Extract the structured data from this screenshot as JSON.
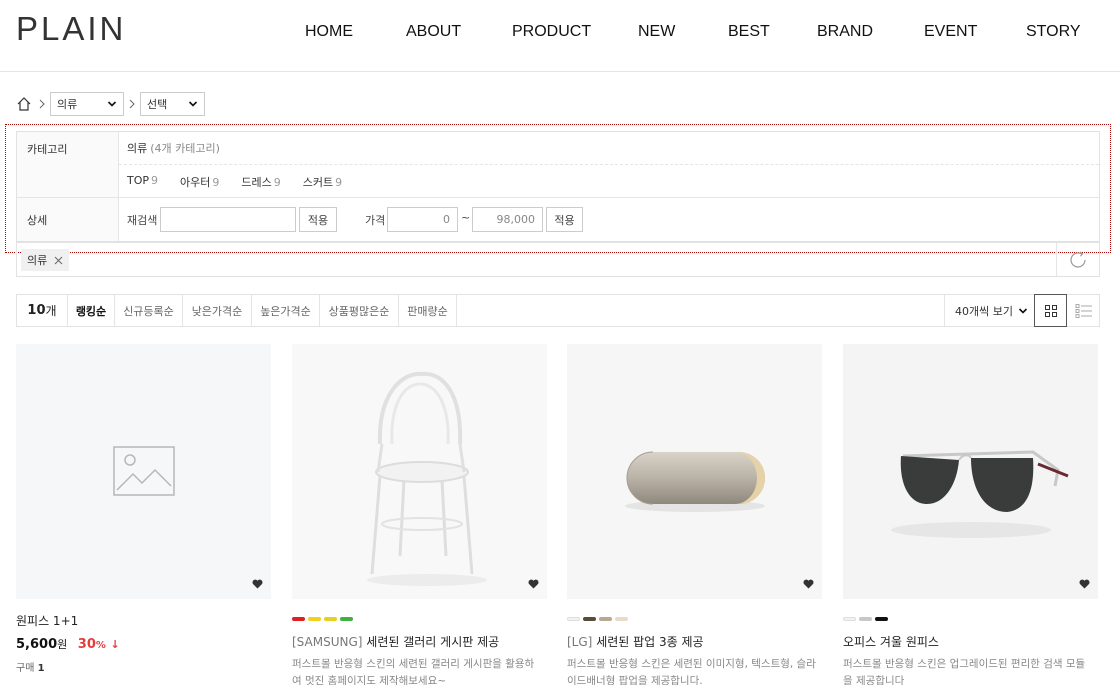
{
  "header": {
    "logo": "PLAIN",
    "nav": [
      "HOME",
      "ABOUT",
      "PRODUCT",
      "NEW",
      "BEST",
      "BRAND",
      "EVENT",
      "STORY"
    ]
  },
  "breadcrumb": {
    "select1": "의류",
    "select2": "선택"
  },
  "filter": {
    "category_label": "카테고리",
    "category_name": "의류",
    "category_sub": "(4개 카테고리)",
    "subcategories": [
      {
        "name": "TOP",
        "count": "9"
      },
      {
        "name": "아우터",
        "count": "9"
      },
      {
        "name": "드레스",
        "count": "9"
      },
      {
        "name": "스커트",
        "count": "9"
      }
    ],
    "detail_label": "상세",
    "research_label": "재검색",
    "apply_label": "적용",
    "price_label": "가격",
    "price_min": "0",
    "price_sep": "~",
    "price_max": "98,000",
    "apply_label2": "적용"
  },
  "tags": {
    "selected": "의류"
  },
  "sort": {
    "count_num": "10",
    "count_unit": "개",
    "options": [
      "랭킹순",
      "신규등록순",
      "낮은가격순",
      "높은가격순",
      "상품평많은순",
      "판매량순"
    ],
    "view_count": "40개씩 보기"
  },
  "products": [
    {
      "name": "원피스 1+1",
      "brand": "",
      "price": "5,600",
      "won": "원",
      "discount": "30",
      "pct": "%",
      "arrow": "↓",
      "buy_label": "구매",
      "buy_count": "1",
      "swatches": [],
      "desc_line1": "",
      "desc_line2": ""
    },
    {
      "name": "세련된 갤러리 게시판 제공",
      "brand": "[SAMSUNG]",
      "swatches": [
        "#e02020",
        "#f0d020",
        "#e8d020",
        "#40b040"
      ],
      "desc_line1": "퍼스트몰 반응형 스킨의 세련된 갤러리 게시판을 활용하",
      "desc_line2": "여 멋진 홈페이지도 제작해보세요~"
    },
    {
      "name": "세련된 팝업 3종 제공",
      "brand": "[LG]",
      "swatches": [
        "#f2f2f2",
        "#5a4a3a",
        "#b8a890",
        "#e8dcc8"
      ],
      "desc_line1": "퍼스트몰 반응형 스킨은 세련된 이미지형, 텍스트형, 슬라",
      "desc_line2": "이드배너형 팝업을 제공합니다."
    },
    {
      "name": "오피스 겨울 원피스",
      "brand": "",
      "swatches": [
        "#f2f2f2",
        "#c8c8c8",
        "#111111"
      ],
      "desc_line1": "퍼스트몰 반응형 스킨은 업그레이드된 편리한 검색 모듈",
      "desc_line2": "을 제공합니다"
    }
  ]
}
